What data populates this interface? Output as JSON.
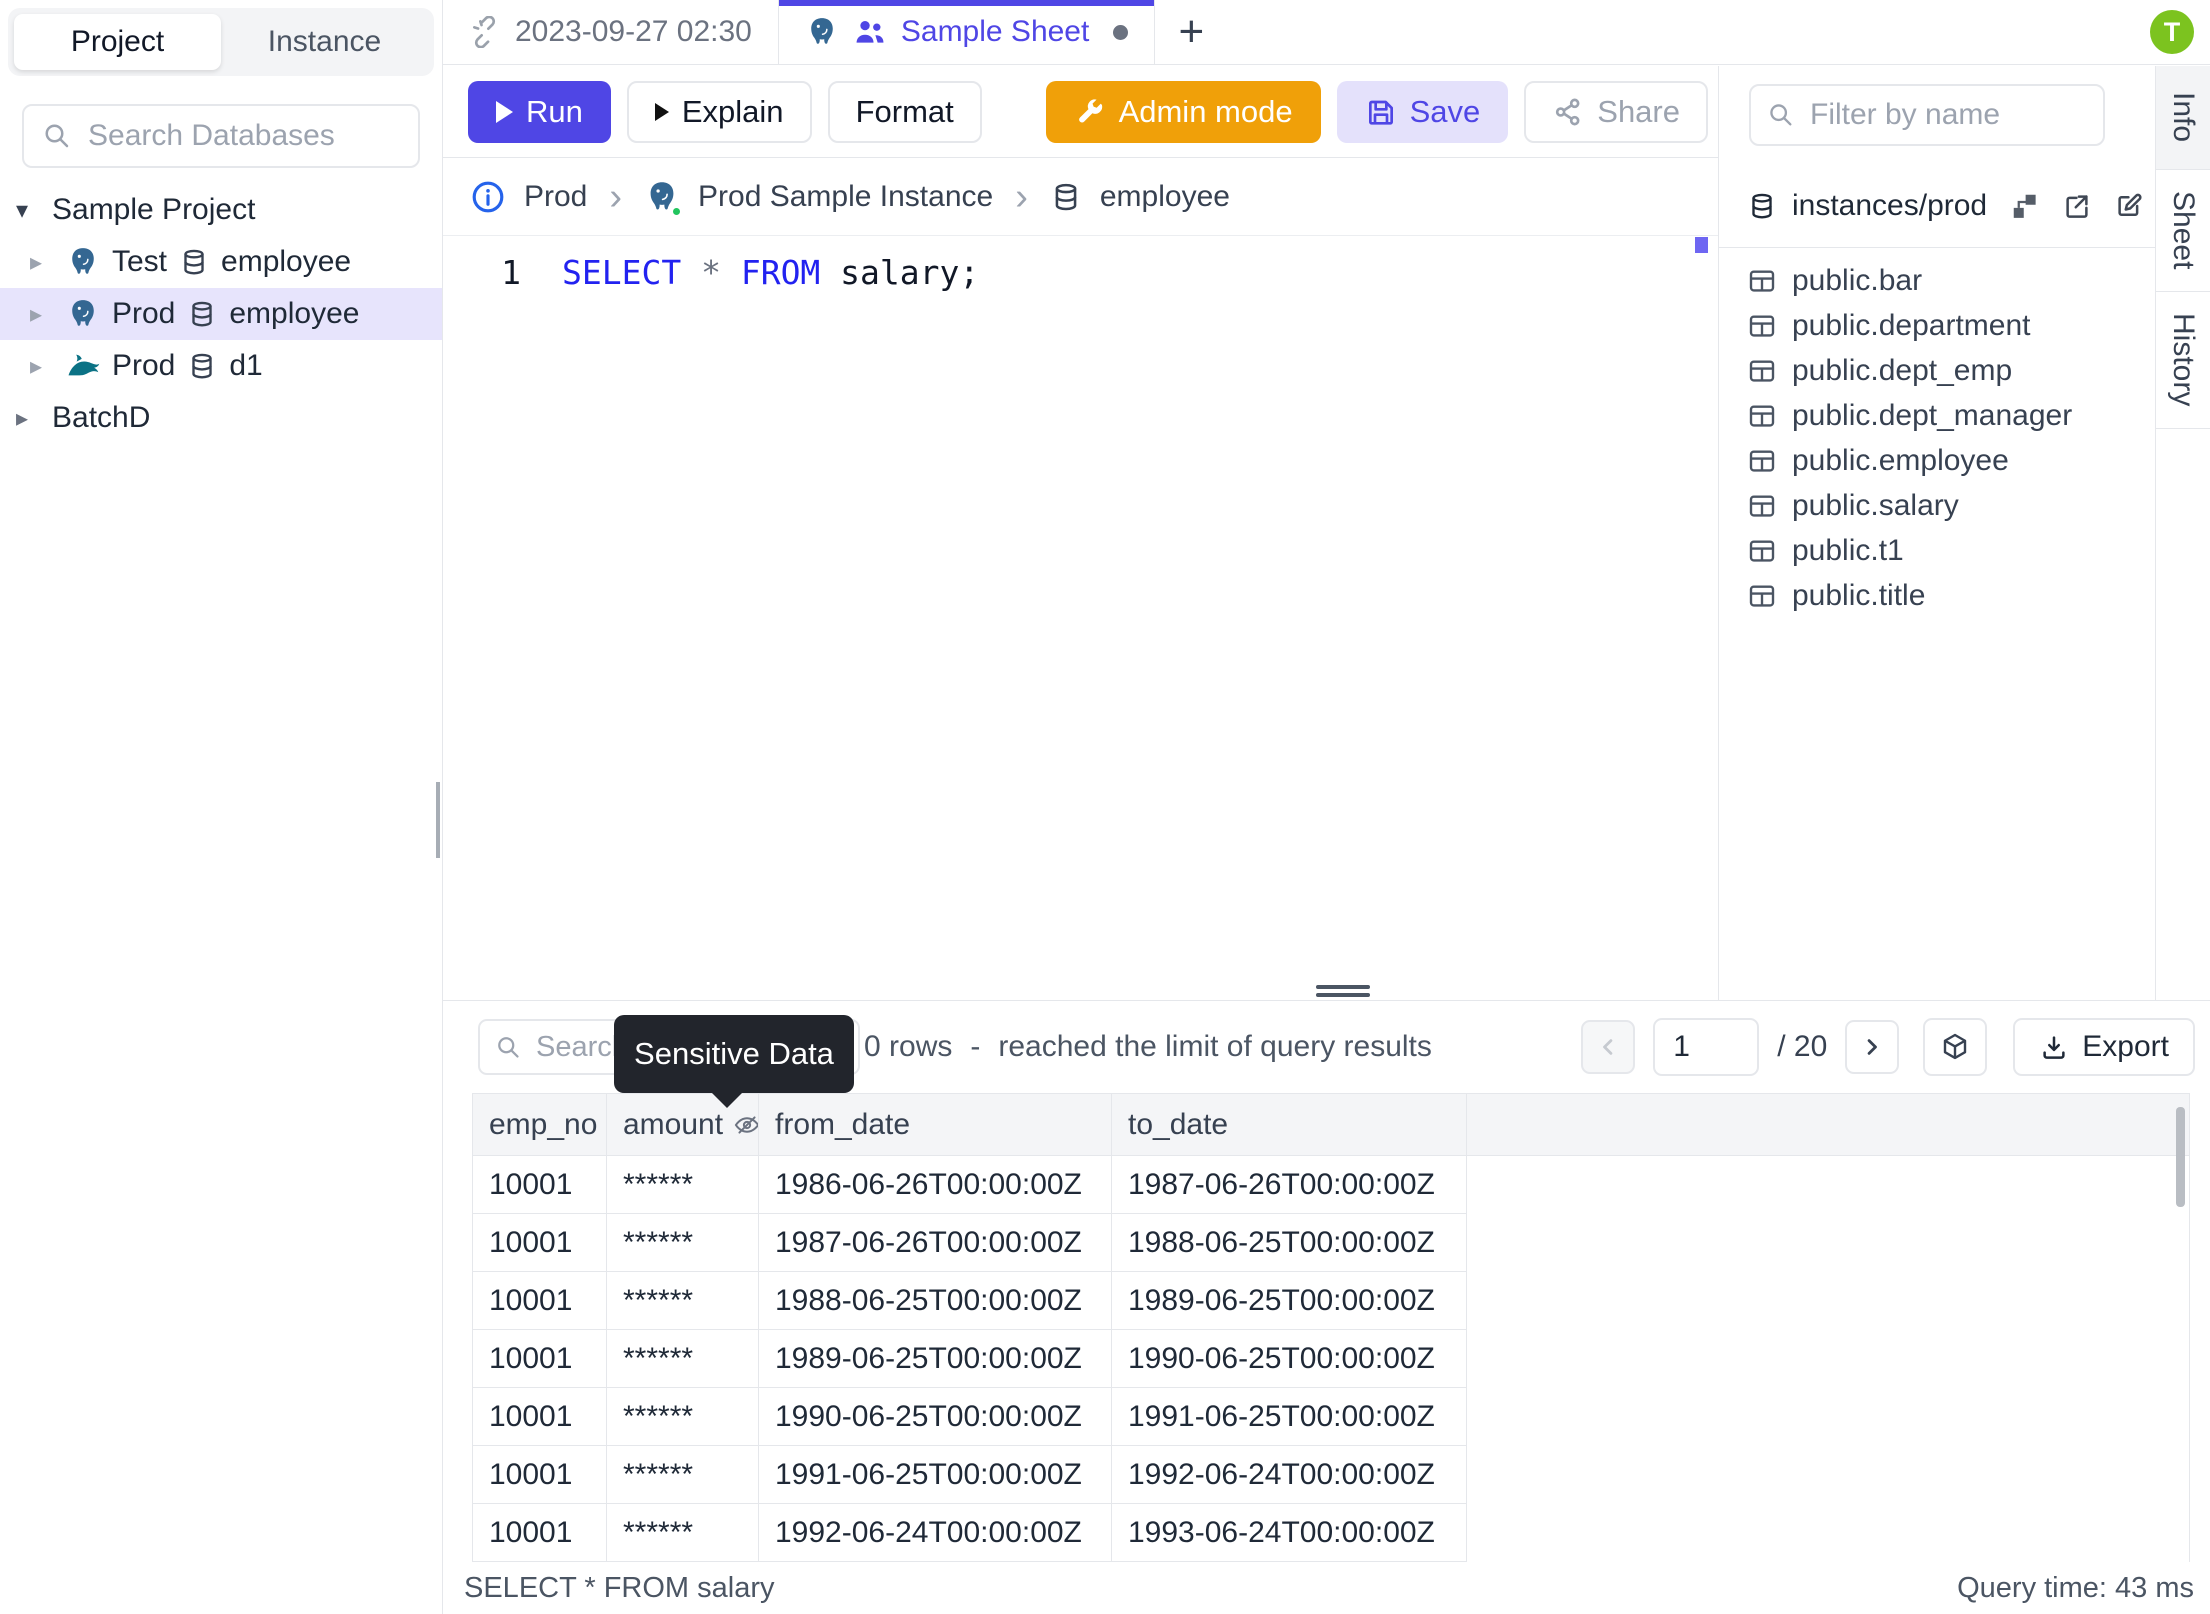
{
  "left_sidebar": {
    "mode_tabs": [
      {
        "label": "Project"
      },
      {
        "label": "Instance"
      }
    ],
    "search_placeholder": "Search Databases",
    "tree": {
      "project": "Sample Project",
      "items": [
        {
          "env": "Test",
          "engine": "postgres",
          "database": "employee"
        },
        {
          "env": "Prod",
          "engine": "postgres",
          "database": "employee",
          "selected": true
        },
        {
          "env": "Prod",
          "engine": "mysql",
          "database": "d1"
        }
      ],
      "collapsed_project": "BatchD"
    }
  },
  "header": {
    "tabs": [
      {
        "label": "2023-09-27 02:30"
      },
      {
        "label": "Sample Sheet",
        "dirty": true
      }
    ],
    "new_tab_label": "+",
    "avatar_initial": "T"
  },
  "toolbar": {
    "run": "Run",
    "explain": "Explain",
    "format": "Format",
    "admin_mode": "Admin mode",
    "save": "Save",
    "share": "Share"
  },
  "breadcrumb": {
    "environment": "Prod",
    "instance": "Prod Sample Instance",
    "database": "employee",
    "separator": "›"
  },
  "editor": {
    "line_number": "1",
    "keyword_select": "SELECT",
    "star": " * ",
    "keyword_from": "FROM",
    "identifier": " salary;"
  },
  "right_sidebar": {
    "filter_placeholder": "Filter by name",
    "instance_path": "instances/prod",
    "tables": [
      "public.bar",
      "public.department",
      "public.dept_emp",
      "public.dept_manager",
      "public.employee",
      "public.salary",
      "public.t1",
      "public.title"
    ]
  },
  "right_rail": {
    "tabs": [
      "Info",
      "Sheet",
      "History"
    ]
  },
  "results": {
    "search_placeholder": "Search",
    "tooltip": "Sensitive Data",
    "rows_summary": "0 rows",
    "summary_separator": "-",
    "limit_note": "reached the limit of query results",
    "page": "1",
    "page_total": "/ 20",
    "export_label": "Export"
  },
  "results_table": {
    "columns": [
      "emp_no",
      "amount",
      "from_date",
      "to_date"
    ],
    "masked_column": "amount",
    "rows": [
      [
        "10001",
        "******",
        "1986-06-26T00:00:00Z",
        "1987-06-26T00:00:00Z"
      ],
      [
        "10001",
        "******",
        "1987-06-26T00:00:00Z",
        "1988-06-25T00:00:00Z"
      ],
      [
        "10001",
        "******",
        "1988-06-25T00:00:00Z",
        "1989-06-25T00:00:00Z"
      ],
      [
        "10001",
        "******",
        "1989-06-25T00:00:00Z",
        "1990-06-25T00:00:00Z"
      ],
      [
        "10001",
        "******",
        "1990-06-25T00:00:00Z",
        "1991-06-25T00:00:00Z"
      ],
      [
        "10001",
        "******",
        "1991-06-25T00:00:00Z",
        "1992-06-24T00:00:00Z"
      ],
      [
        "10001",
        "******",
        "1992-06-24T00:00:00Z",
        "1993-06-24T00:00:00Z"
      ]
    ]
  },
  "status_bar": {
    "statement": "SELECT * FROM salary",
    "query_time": "Query time: 43 ms"
  },
  "colors": {
    "accent": "#4f46e5",
    "admin_mode": "#F0A009",
    "avatar": "#7CC31F",
    "sql_keyword": "#2222f0",
    "selected_row": "#e7e4fc",
    "tooltip_bg": "#22252c",
    "status_ok": "#22c55e"
  }
}
